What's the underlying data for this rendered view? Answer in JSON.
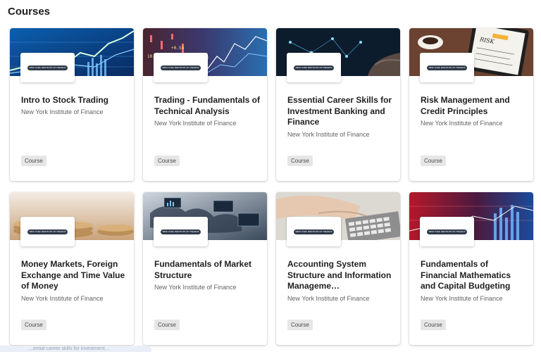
{
  "page": {
    "title": "Courses"
  },
  "colors": {
    "title": "#1f1f1f",
    "partner_text": "#636363",
    "badge_bg": "#e6e6e6",
    "logo_pill": "#2f3a4a"
  },
  "courses": [
    {
      "title": "Intro to Stock Trading",
      "partner": "New York Institute of Finance",
      "badge": "Course",
      "logo_text": "NEW YORK INSTITUTE OF FINANCE",
      "image": "stock-chart-blue"
    },
    {
      "title": "Trading - Fundamentals of Technical Analysis",
      "partner": "New York Institute of Finance",
      "badge": "Course",
      "logo_text": "NEW YORK INSTITUTE OF FINANCE",
      "image": "candlestick-red-blue"
    },
    {
      "title": "Essential Career Skills for Investment Banking and Finance",
      "partner": "New York Institute of Finance",
      "badge": "Course",
      "logo_text": "NEW YORK INSTITUTE OF FINANCE",
      "image": "network-hand-dark"
    },
    {
      "title": "Risk Management and Credit Principles",
      "partner": "New York Institute of Finance",
      "badge": "Course",
      "logo_text": "NEW YORK INSTITUTE OF FINANCE",
      "image": "tablet-risk-coffee"
    },
    {
      "title": "Money Markets, Foreign Exchange and Time Value of Money",
      "partner": "New York Institute of Finance",
      "badge": "Course",
      "logo_text": "NEW YORK INSTITUTE OF FINANCE",
      "image": "coins-warm"
    },
    {
      "title": "Fundamentals of Market Structure",
      "partner": "New York Institute of Finance",
      "badge": "Course",
      "logo_text": "NEW YORK INSTITUTE OF FINANCE",
      "image": "world-map-screens"
    },
    {
      "title": "Accounting System Structure and Information Manageme…",
      "partner": "New York Institute of Finance",
      "badge": "Course",
      "logo_text": "NEW YORK INSTITUTE OF FINANCE",
      "image": "hand-calculator"
    },
    {
      "title": "Fundamentals of Financial Mathematics and Capital Budgeting",
      "partner": "New York Institute of Finance",
      "badge": "Course",
      "logo_text": "NEW YORK INSTITUTE OF FINANCE",
      "image": "red-blue-chart"
    }
  ],
  "footer": {
    "hint": "…ential career skills for investment…"
  }
}
